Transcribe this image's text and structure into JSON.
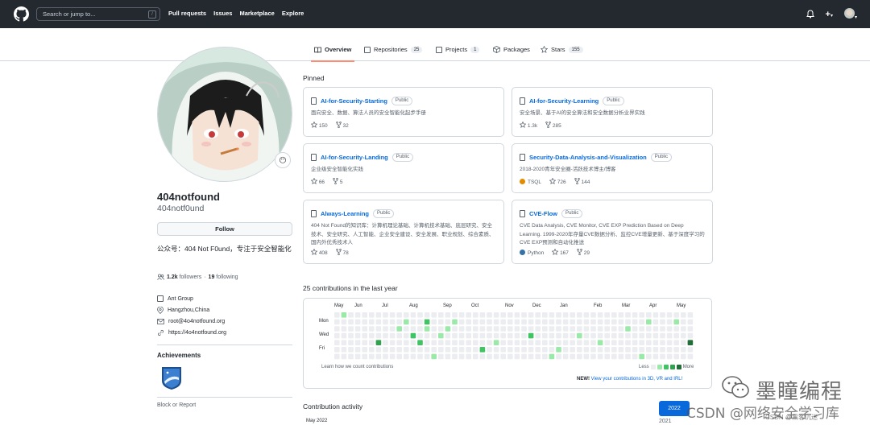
{
  "header": {
    "search_placeholder": "Search or jump to...",
    "search_key": "/",
    "nav": [
      "Pull requests",
      "Issues",
      "Marketplace",
      "Explore"
    ],
    "plus": "+",
    "caret": "▾"
  },
  "tabs": [
    {
      "label": "Overview",
      "count": ""
    },
    {
      "label": "Repositories",
      "count": "25"
    },
    {
      "label": "Projects",
      "count": "1"
    },
    {
      "label": "Packages",
      "count": ""
    },
    {
      "label": "Stars",
      "count": "155"
    }
  ],
  "profile": {
    "name": "404notfound",
    "login": "404notf0und",
    "follow": "Follow",
    "bio": "公众号：404 Not F0und，专注于安全智能化",
    "followers_count": "1.2k",
    "followers_label": "followers",
    "dot": "·",
    "following_count": "19",
    "following_label": "following",
    "company": "Ant Group",
    "location": "Hangzhou,China",
    "email": "root@4o4notfound.org",
    "website": "https://4o4notfound.org",
    "achievements": "Achievements",
    "block": "Block or Report",
    "status_emoji": "😶"
  },
  "pinned": {
    "title": "Pinned",
    "cards": [
      {
        "name": "AI-for-Security-Starting",
        "vis": "Public",
        "desc": "面向安全、数据、算法人员的安全智能化起步手册",
        "lang": "",
        "lang_color": "",
        "stars": "150",
        "forks": "32"
      },
      {
        "name": "AI-for-Security-Learning",
        "vis": "Public",
        "desc": "安全场景、基于AI的安全算法和安全数据分析业界实践",
        "lang": "",
        "lang_color": "",
        "stars": "1.3k",
        "forks": "285"
      },
      {
        "name": "AI-for-Security-Landing",
        "vis": "Public",
        "desc": "企业级安全智能化实践",
        "lang": "",
        "lang_color": "",
        "stars": "66",
        "forks": "5"
      },
      {
        "name": "Security-Data-Analysis-and-Visualization",
        "vis": "Public",
        "desc": "2018-2020青年安全圈-活跃技术博主/博客",
        "lang": "TSQL",
        "lang_color": "#e38c00",
        "stars": "726",
        "forks": "144"
      },
      {
        "name": "Always-Learning",
        "vis": "Public",
        "desc": "404 Not Found的知识库：计算机理论基础、计算机技术基础、底层研究、安全技术、安全研究、人工智能、企业安全建设、安全发展、职业规划、综合素质、国内外优秀技术人",
        "lang": "",
        "lang_color": "",
        "stars": "408",
        "forks": "78"
      },
      {
        "name": "CVE-Flow",
        "vis": "Public",
        "desc": "CVE Data Analysis, CVE Monitor, CVE EXP Prediction Based on Deep Learning. 1999-2020年存量CVE数据分析、监控CVE增量更新、基于深度学习的CVE EXP预测和自动化推送",
        "lang": "Python",
        "lang_color": "#3572A5",
        "stars": "167",
        "forks": "29"
      }
    ]
  },
  "contributions": {
    "title": "25 contributions in the last year",
    "months": [
      "May",
      "Jun",
      "Jul",
      "Aug",
      "Sep",
      "Oct",
      "Nov",
      "Dec",
      "Jan",
      "Feb",
      "Mar",
      "Apr",
      "May"
    ],
    "days": [
      "Mon",
      "Wed",
      "Fri"
    ],
    "learn": "Learn how we count contributions",
    "less": "Less",
    "more": "More",
    "new_prefix": "NEW!",
    "new_link": "View your contributions in 3D, VR and IRL!",
    "colors": [
      "#ebedf0",
      "#9be9a8",
      "#40c463",
      "#30a14e",
      "#216e39"
    ]
  },
  "activity": {
    "title": "Contribution activity",
    "year": "2022",
    "prev_year": "2021",
    "month": "May 2022"
  },
  "watermark": {
    "brand": "墨瞳编程",
    "csdn": "CSDN @网络安全学习库",
    "sub": "CSDN @黑客沉迷"
  }
}
